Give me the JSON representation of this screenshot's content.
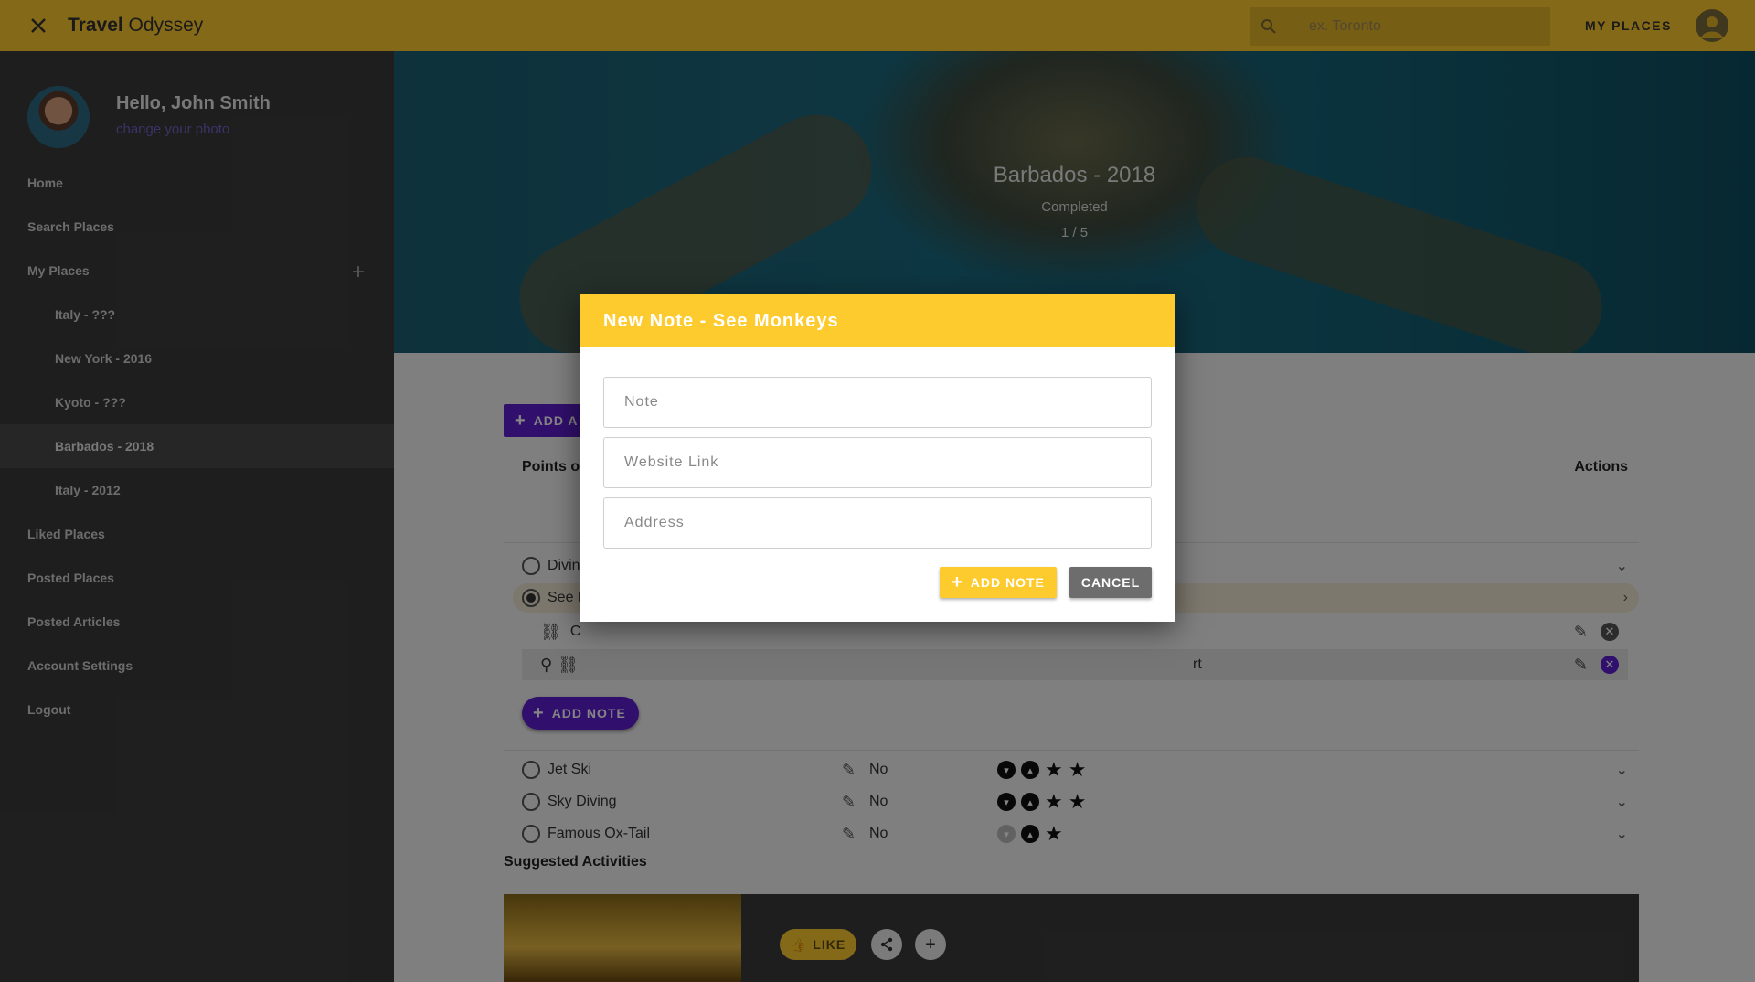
{
  "header": {
    "brand_bold": "Travel",
    "brand_rest": " Odyssey",
    "search_placeholder": "ex. Toronto",
    "my_places_label": "MY PLACES"
  },
  "sidebar": {
    "greeting": "Hello, John Smith",
    "change_photo": "change your photo",
    "items": [
      {
        "label": "Home"
      },
      {
        "label": "Search Places"
      },
      {
        "label": "My Places"
      },
      {
        "label": "Italy - ???"
      },
      {
        "label": "New York - 2016"
      },
      {
        "label": "Kyoto - ???"
      },
      {
        "label": "Barbados - 2018"
      },
      {
        "label": "Italy - 2012"
      },
      {
        "label": "Liked Places"
      },
      {
        "label": "Posted Places"
      },
      {
        "label": "Posted Articles"
      },
      {
        "label": "Account Settings"
      },
      {
        "label": "Logout"
      }
    ],
    "active_item": "Barbados - 2018"
  },
  "hero": {
    "title": "Barbados - 2018",
    "status": "Completed",
    "count": "1 / 5"
  },
  "main": {
    "add_activity_label": "ADD A",
    "col_poi": "Points of",
    "col_actions": "Actions",
    "rows": [
      {
        "name": "Divin"
      },
      {
        "name": "See M"
      }
    ],
    "subrow1_text": "C",
    "subrow2_tail": "rt",
    "add_note_label": "ADD NOTE",
    "activities": [
      {
        "name": "Jet Ski",
        "flag": "No",
        "stars": 2
      },
      {
        "name": "Sky Diving",
        "flag": "No",
        "stars": 2
      },
      {
        "name": "Famous Ox-Tail",
        "flag": "No",
        "stars": 1
      }
    ],
    "suggested_title": "Suggested Activities",
    "like_label": "LIKE"
  },
  "dialog": {
    "title": "New Note - See Monkeys",
    "note_placeholder": "Note",
    "website_placeholder": "Website Link",
    "address_placeholder": "Address",
    "add_label": "ADD NOTE",
    "cancel_label": "CANCEL"
  },
  "colors": {
    "accent_yellow": "#fecb2f",
    "accent_purple": "#5e1ed0",
    "sidebar_bg": "#3b3b3b"
  }
}
